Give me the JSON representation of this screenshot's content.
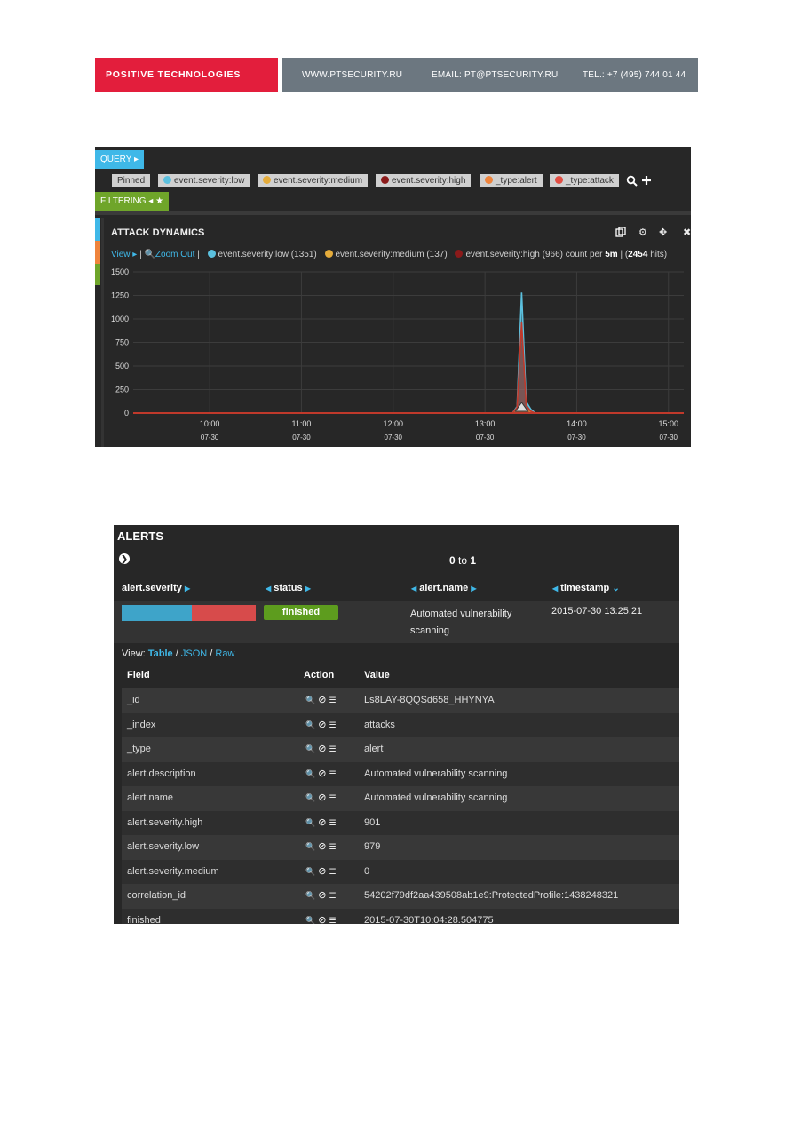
{
  "header": {
    "brand": "POSITIVE TECHNOLOGIES",
    "website": "WWW.PTSECURITY.RU",
    "email": "EMAIL: PT@PTSECURITY.RU",
    "phone": "TEL.: +7 (495) 744 01 44"
  },
  "dashboard": {
    "query_label": "QUERY",
    "pinned_label": "Pinned",
    "filters": [
      {
        "label": "event.severity:low",
        "color": "#5bc0de"
      },
      {
        "label": "event.severity:medium",
        "color": "#e5ac3b"
      },
      {
        "label": "event.severity:high",
        "color": "#8b1a1a"
      },
      {
        "label": "_type:alert",
        "color": "#ef843c"
      },
      {
        "label": "_type:attack",
        "color": "#e24d42"
      }
    ],
    "filtering_label": "FILTERING",
    "panel_title": "ATTACK DYNAMICS",
    "legend": {
      "view": "View",
      "zoom_out": "Zoom Out",
      "items": [
        {
          "label": "event.severity:low (1351)",
          "color": "#5bc0de"
        },
        {
          "label": "event.severity:medium (137)",
          "color": "#e5ac3b"
        },
        {
          "label": "event.severity:high (966)",
          "color": "#8b1a1a"
        }
      ],
      "count_prefix": "count per",
      "interval": "5m",
      "hits_total": "2454",
      "hits_suffix": "hits"
    }
  },
  "chart_data": {
    "type": "area",
    "title": "ATTACK DYNAMICS",
    "ylim": [
      0,
      1500
    ],
    "y_ticks": [
      "0",
      "250",
      "500",
      "750",
      "1000",
      "1250",
      "1500"
    ],
    "x_ticks": [
      {
        "time": "10:00",
        "date": "07-30"
      },
      {
        "time": "11:00",
        "date": "07-30"
      },
      {
        "time": "12:00",
        "date": "07-30"
      },
      {
        "time": "13:00",
        "date": "07-30"
      },
      {
        "time": "14:00",
        "date": "07-30"
      },
      {
        "time": "15:00",
        "date": "07-30"
      }
    ],
    "x_minutes": [
      550,
      600,
      660,
      720,
      780,
      798,
      801,
      804,
      807,
      810,
      813,
      816,
      825,
      840,
      900,
      910
    ],
    "series": [
      {
        "name": "event.severity:low",
        "color": "#5bc0de",
        "values": [
          0,
          0,
          0,
          0,
          0,
          0,
          70,
          1280,
          120,
          40,
          0,
          0,
          0,
          0,
          0,
          0
        ]
      },
      {
        "name": "event.severity:medium",
        "color": "#e5ac3b",
        "values": [
          0,
          0,
          0,
          0,
          0,
          0,
          40,
          60,
          30,
          10,
          0,
          0,
          0,
          0,
          0,
          0
        ]
      },
      {
        "name": "event.severity:high",
        "color": "#c0392b",
        "values": [
          0,
          0,
          0,
          0,
          0,
          0,
          60,
          966,
          80,
          20,
          0,
          0,
          0,
          0,
          0,
          0
        ]
      }
    ],
    "grid": true
  },
  "alerts": {
    "title": "ALERTS",
    "pager_from": "0",
    "pager_to_word": "to",
    "pager_to": "1",
    "columns": [
      "alert.severity",
      "status",
      "alert.name",
      "timestamp"
    ],
    "row": {
      "severity_split": {
        "high": 0.52,
        "low": 0.48
      },
      "status": "finished",
      "name": "Automated vulnerability scanning",
      "timestamp": "2015-07-30 13:25:21"
    },
    "view_prefix": "View:",
    "view_table": "Table",
    "view_json": "JSON",
    "view_raw": "Raw",
    "table_headers": {
      "field": "Field",
      "action": "Action",
      "value": "Value"
    },
    "fields": [
      {
        "field": "_id",
        "value": "Ls8LAY-8QQSd658_HHYNYA"
      },
      {
        "field": "_index",
        "value": "attacks"
      },
      {
        "field": "_type",
        "value": "alert"
      },
      {
        "field": "alert.description",
        "value": "Automated vulnerability scanning"
      },
      {
        "field": "alert.name",
        "value": "Automated vulnerability scanning"
      },
      {
        "field": "alert.severity.high",
        "value": "901"
      },
      {
        "field": "alert.severity.low",
        "value": "979"
      },
      {
        "field": "alert.severity.medium",
        "value": "0"
      },
      {
        "field": "correlation_id",
        "value": "54202f79df2aa439508ab1e9:ProtectedProfile:1438248321"
      },
      {
        "field": "finished",
        "value": "2015-07-30T10:04:28.504775"
      }
    ]
  }
}
